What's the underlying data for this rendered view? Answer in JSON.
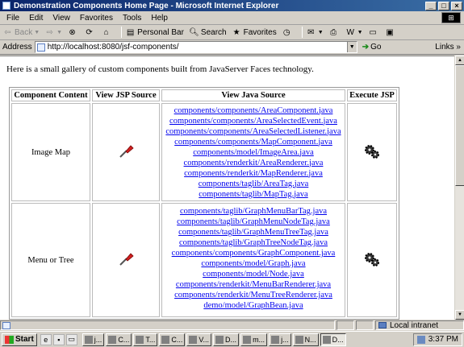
{
  "window": {
    "title": "Demonstration Components Home Page - Microsoft Internet Explorer",
    "buttons": [
      "_",
      "□",
      "×"
    ]
  },
  "menu": [
    "File",
    "Edit",
    "View",
    "Favorites",
    "Tools",
    "Help"
  ],
  "toolbar": {
    "back": "Back",
    "personal_bar": "Personal Bar",
    "search": "Search",
    "favorites": "Favorites"
  },
  "address": {
    "label": "Address",
    "url": "http://localhost:8080/jsf-components/",
    "go": "Go",
    "links": "Links"
  },
  "page": {
    "intro": "Here is a small gallery of custom components built from JavaServer Faces technology.",
    "headers": [
      "Component Content",
      "View JSP Source",
      "View Java Source",
      "Execute JSP"
    ],
    "rows": [
      {
        "name": "Image Map",
        "java_links": [
          "components/components/AreaComponent.java",
          "components/components/AreaSelectedEvent.java",
          "components/components/AreaSelectedListener.java",
          "components/components/MapComponent.java",
          "components/model/ImageArea.java",
          "components/renderkit/AreaRenderer.java",
          "components/renderkit/MapRenderer.java",
          "components/taglib/AreaTag.java",
          "components/taglib/MapTag.java"
        ]
      },
      {
        "name": "Menu or Tree",
        "java_links": [
          "components/taglib/GraphMenuBarTag.java",
          "components/taglib/GraphMenuNodeTag.java",
          "components/taglib/GraphMenuTreeTag.java",
          "components/taglib/GraphTreeNodeTag.java",
          "components/components/GraphComponent.java",
          "components/model/Graph.java",
          "components/model/Node.java",
          "components/renderkit/MenuBarRenderer.java",
          "components/renderkit/MenuTreeRenderer.java",
          "demo/model/GraphBean.java"
        ]
      }
    ]
  },
  "status": {
    "zone": "Local intranet"
  },
  "taskbar": {
    "start": "Start",
    "tasks": [
      "j...",
      "C...",
      "T...",
      "C...",
      "V...",
      "D...",
      "m...",
      "j...",
      "N...",
      "D..."
    ],
    "time": "3:37 PM"
  }
}
